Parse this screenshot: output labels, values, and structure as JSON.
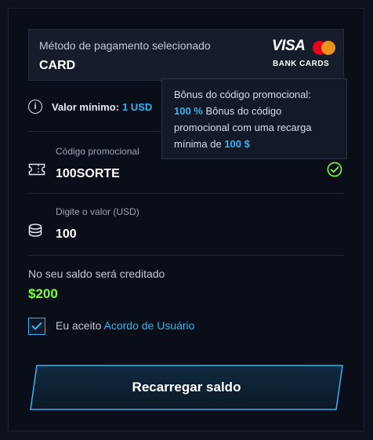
{
  "payment_method": {
    "label": "Método de pagamento selecionado",
    "value": "CARD",
    "brand_visa": "VISA",
    "brand_caption": "BANK CARDS"
  },
  "minimum": {
    "label": "Valor mínimo:",
    "value": "1 USD"
  },
  "tooltip": {
    "title": "Bônus do código promocional:",
    "percent": "100 %",
    "text_before": "Bônus do código promocional com uma recarga mínima de",
    "amount": "100 $"
  },
  "promo": {
    "label": "Código promocional",
    "value": "100SORTE",
    "icon": "ticket-icon",
    "status_icon": "check-circle-icon"
  },
  "amount": {
    "label": "Digite o valor (USD)",
    "value": "100",
    "icon": "coins-icon"
  },
  "credit": {
    "label": "No seu saldo será creditado",
    "value": "$200"
  },
  "agreement": {
    "text": "Eu aceito",
    "link": "Acordo de Usuário",
    "checked": true
  },
  "cta": {
    "label": "Recarregar saldo"
  },
  "colors": {
    "accent": "#35b3f2",
    "success": "#7dff3c",
    "background": "#0a0e19"
  }
}
